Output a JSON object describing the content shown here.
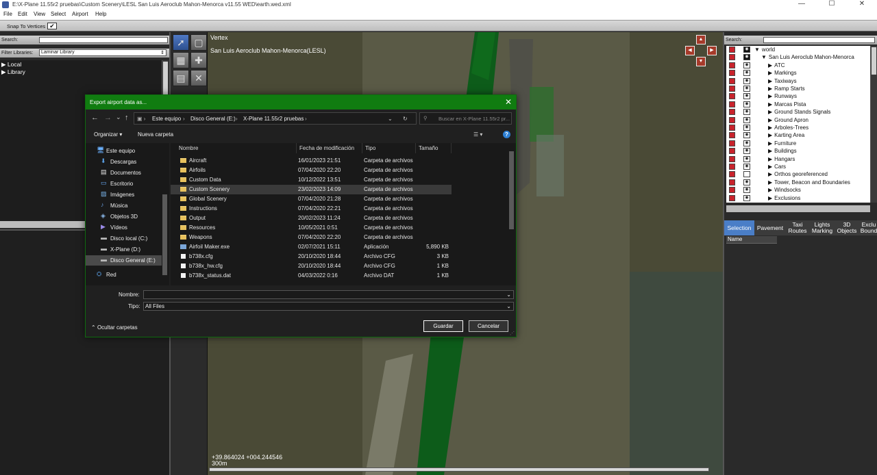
{
  "window": {
    "title": "E:\\X-Plane 11.55r2 pruebas\\Custom Scenery\\LESL San Luis Aeroclub Mahon-Menorca v11.55 WED\\earth.wed.xml",
    "minimize": "—",
    "maximize": "☐",
    "close": "✕"
  },
  "menu": [
    "File",
    "Edit",
    "View",
    "Select",
    "Airport",
    "Help"
  ],
  "snap": {
    "label": "Snap To Vertices",
    "check": "✔"
  },
  "library": {
    "search_label": "Search:",
    "filter_label": "Filter Libraries:",
    "filter_value": "Laminar Library",
    "items": [
      {
        "arrow": "▶",
        "label": "Local"
      },
      {
        "arrow": "▶",
        "label": "Library"
      }
    ]
  },
  "map": {
    "tool_name": "Vertex",
    "airport_name": "San Luis Aeroclub Mahon-Menorca(LESL)",
    "coords": "+39.864024 +004.244546",
    "scale": "300m"
  },
  "layers": {
    "search_label": "Search:",
    "items": [
      {
        "name": "world",
        "arrow": "▼",
        "indent": 0,
        "eye": "dark"
      },
      {
        "name": "San Luis Aeroclub Mahon-Menorca",
        "arrow": "▼",
        "indent": 1,
        "eye": "dark"
      },
      {
        "name": "ATC",
        "arrow": "▶",
        "indent": 2,
        "eye": "light"
      },
      {
        "name": "Markings",
        "arrow": "▶",
        "indent": 2,
        "eye": "light"
      },
      {
        "name": "Taxiways",
        "arrow": "▶",
        "indent": 2,
        "eye": "light"
      },
      {
        "name": "Ramp Starts",
        "arrow": "▶",
        "indent": 2,
        "eye": "light"
      },
      {
        "name": "Runways",
        "arrow": "▶",
        "indent": 2,
        "eye": "light"
      },
      {
        "name": "Marcas Pista",
        "arrow": "▶",
        "indent": 2,
        "eye": "light"
      },
      {
        "name": "Ground Stands Signals",
        "arrow": "▶",
        "indent": 2,
        "eye": "light"
      },
      {
        "name": "Ground Apron",
        "arrow": "▶",
        "indent": 2,
        "eye": "light"
      },
      {
        "name": "Arboles-Trees",
        "arrow": "▶",
        "indent": 2,
        "eye": "light"
      },
      {
        "name": "Karting Area",
        "arrow": "▶",
        "indent": 2,
        "eye": "light"
      },
      {
        "name": "Furniture",
        "arrow": "▶",
        "indent": 2,
        "eye": "light"
      },
      {
        "name": "Buildings",
        "arrow": "▶",
        "indent": 2,
        "eye": "light"
      },
      {
        "name": "Hangars",
        "arrow": "▶",
        "indent": 2,
        "eye": "light"
      },
      {
        "name": "Cars",
        "arrow": "▶",
        "indent": 2,
        "eye": "light"
      },
      {
        "name": "Orthos georeferenced",
        "arrow": "▶",
        "indent": 2,
        "eye": "none"
      },
      {
        "name": "Tower, Beacon and Boundaries",
        "arrow": "▶",
        "indent": 2,
        "eye": "light"
      },
      {
        "name": "Windsocks",
        "arrow": "▶",
        "indent": 2,
        "eye": "light"
      },
      {
        "name": "Exclusions",
        "arrow": "▶",
        "indent": 2,
        "eye": "light"
      }
    ]
  },
  "tabs": [
    {
      "label": "Selection",
      "active": true
    },
    {
      "label": "Pavement",
      "active": false
    },
    {
      "label": "Taxi Routes",
      "active": false
    },
    {
      "label": "Lights Marking",
      "active": false
    },
    {
      "label": "3D Objects",
      "active": false
    },
    {
      "label": "Exclu Bound",
      "active": false
    }
  ],
  "props": {
    "name_header": "Name"
  },
  "dialog": {
    "title": "Export airport data as...",
    "close": "✕",
    "nav": {
      "back": "←",
      "forward": "→",
      "down": "⌄",
      "up": "↑"
    },
    "breadcrumb": [
      "Este equipo",
      "Disco General (E:)",
      "X-Plane 11.55r2 pruebas"
    ],
    "search_placeholder": "Buscar en X-Plane 11.55r2 pr...",
    "organize": "Organizar ▾",
    "new_folder": "Nueva carpeta",
    "help": "?",
    "nav_pane": [
      {
        "label": "Este equipo",
        "icon": "pc",
        "level": 0
      },
      {
        "label": "Descargas",
        "icon": "download",
        "level": 1
      },
      {
        "label": "Documentos",
        "icon": "doc",
        "level": 1
      },
      {
        "label": "Escritorio",
        "icon": "desktop",
        "level": 1
      },
      {
        "label": "Imágenes",
        "icon": "image",
        "level": 1
      },
      {
        "label": "Música",
        "icon": "music",
        "level": 1
      },
      {
        "label": "Objetos 3D",
        "icon": "cube",
        "level": 1
      },
      {
        "label": "Vídeos",
        "icon": "video",
        "level": 1
      },
      {
        "label": "Disco local (C:)",
        "icon": "drive",
        "level": 1
      },
      {
        "label": "X-Plane (D:)",
        "icon": "drive",
        "level": 1
      },
      {
        "label": "Disco General (E:)",
        "icon": "drive",
        "level": 1,
        "selected": true
      },
      {
        "label": "Red",
        "icon": "network",
        "level": 0
      }
    ],
    "columns": [
      "Nombre",
      "Fecha de modificación",
      "Tipo",
      "Tamaño"
    ],
    "files": [
      {
        "name": "Aircraft",
        "date": "16/01/2023 21:51",
        "type": "Carpeta de archivos",
        "size": "",
        "icon": "folder"
      },
      {
        "name": "Airfoils",
        "date": "07/04/2020 22:20",
        "type": "Carpeta de archivos",
        "size": "",
        "icon": "folder"
      },
      {
        "name": "Custom Data",
        "date": "10/12/2022 13:51",
        "type": "Carpeta de archivos",
        "size": "",
        "icon": "folder"
      },
      {
        "name": "Custom Scenery",
        "date": "23/02/2023 14:09",
        "type": "Carpeta de archivos",
        "size": "",
        "icon": "folder",
        "selected": true
      },
      {
        "name": "Global Scenery",
        "date": "07/04/2020 21:28",
        "type": "Carpeta de archivos",
        "size": "",
        "icon": "folder"
      },
      {
        "name": "Instructions",
        "date": "07/04/2020 22:21",
        "type": "Carpeta de archivos",
        "size": "",
        "icon": "folder"
      },
      {
        "name": "Output",
        "date": "20/02/2023 11:24",
        "type": "Carpeta de archivos",
        "size": "",
        "icon": "folder"
      },
      {
        "name": "Resources",
        "date": "10/05/2021 0:51",
        "type": "Carpeta de archivos",
        "size": "",
        "icon": "folder"
      },
      {
        "name": "Weapons",
        "date": "07/04/2020 22:20",
        "type": "Carpeta de archivos",
        "size": "",
        "icon": "folder"
      },
      {
        "name": "Airfoil Maker.exe",
        "date": "02/07/2021 15:11",
        "type": "Aplicación",
        "size": "5,890 KB",
        "icon": "exe"
      },
      {
        "name": "b738x.cfg",
        "date": "20/10/2020 18:44",
        "type": "Archivo CFG",
        "size": "3 KB",
        "icon": "file"
      },
      {
        "name": "b738x_hw.cfg",
        "date": "20/10/2020 18:44",
        "type": "Archivo CFG",
        "size": "1 KB",
        "icon": "file"
      },
      {
        "name": "b738x_status.dat",
        "date": "04/03/2022 0:16",
        "type": "Archivo DAT",
        "size": "1 KB",
        "icon": "file"
      }
    ],
    "filename_label": "Nombre:",
    "filename_value": "",
    "type_label": "Tipo:",
    "type_value": "All Files",
    "hide_folders": "Ocultar carpetas",
    "save": "Guardar",
    "cancel": "Cancelar"
  }
}
